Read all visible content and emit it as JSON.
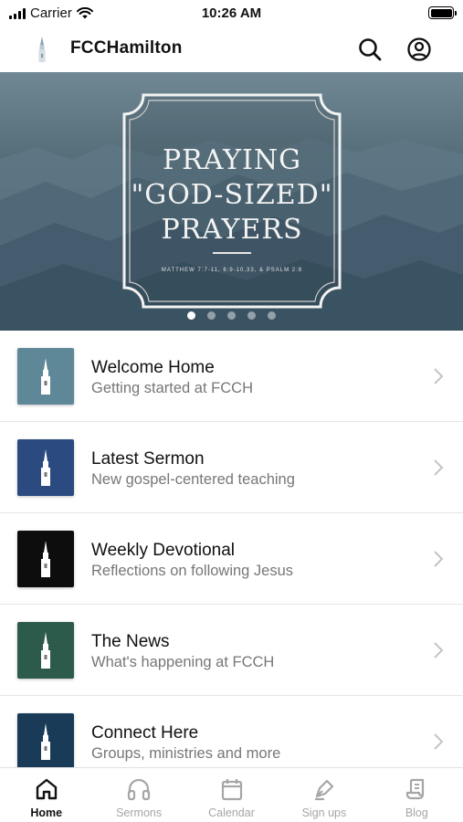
{
  "status_bar": {
    "carrier": "Carrier",
    "time": "10:26 AM"
  },
  "header": {
    "title": "FCCHamilton",
    "search_icon": "search-icon",
    "profile_icon": "account-circle-icon"
  },
  "hero": {
    "title_lines": [
      "PRAYING",
      "\"GOD-SIZED\"",
      "PRAYERS"
    ],
    "reference": "MATTHEW 7:7-11, 6:9-10,33, & PSALM 2:8",
    "slide_count": 5,
    "active_slide": 1
  },
  "list": {
    "items": [
      {
        "title": "Welcome Home",
        "subtitle": "Getting started at FCCH",
        "color": "#5e8797",
        "icon": "steeple-icon"
      },
      {
        "title": "Latest Sermon",
        "subtitle": "New gospel-centered teaching",
        "color": "#2a4a80",
        "icon": "steeple-icon"
      },
      {
        "title": "Weekly Devotional",
        "subtitle": "Reflections on following Jesus",
        "color": "#0d0d0d",
        "icon": "steeple-icon"
      },
      {
        "title": "The News",
        "subtitle": "What's happening at FCCH",
        "color": "#2c5a4b",
        "icon": "steeple-icon"
      },
      {
        "title": "Connect Here",
        "subtitle": "Groups, ministries and more",
        "color": "#193b57",
        "icon": "steeple-icon"
      }
    ]
  },
  "tabs": [
    {
      "label": "Home",
      "icon": "home-icon",
      "active": true
    },
    {
      "label": "Sermons",
      "icon": "headphones-icon",
      "active": false
    },
    {
      "label": "Calendar",
      "icon": "calendar-icon",
      "active": false
    },
    {
      "label": "Sign ups",
      "icon": "pen-icon",
      "active": false
    },
    {
      "label": "Blog",
      "icon": "scroll-icon",
      "active": false
    }
  ],
  "colors": {
    "accent": "#111111",
    "inactive_tab": "#a6a6a6",
    "divider": "#e5e5e5"
  }
}
